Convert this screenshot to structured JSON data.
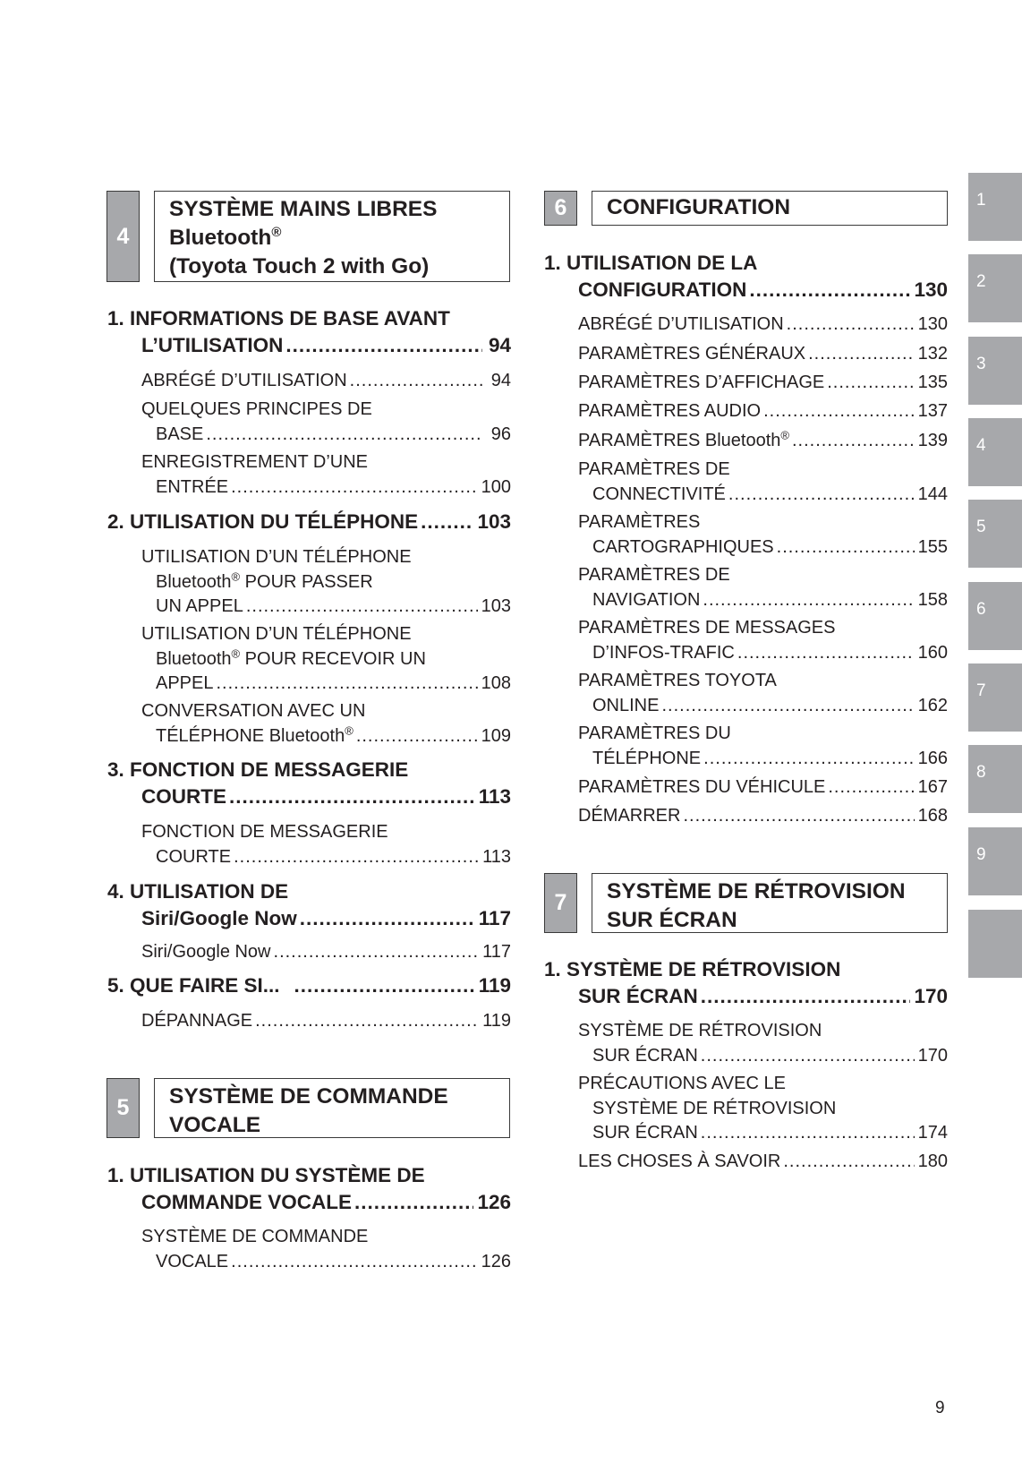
{
  "side_tabs": [
    "1",
    "2",
    "3",
    "4",
    "5",
    "6",
    "7",
    "8",
    "9",
    ""
  ],
  "page_number": "9",
  "chapter4": {
    "number": "4",
    "title_line1": "SYSTÈME MAINS LIBRES",
    "title_line2": "Bluetooth",
    "title_line2_sup": "®",
    "title_line3": "(Toyota Touch 2 with Go)",
    "sections": [
      {
        "label_l1": "1. INFORMATIONS DE BASE AVANT",
        "label_l2": "L’UTILISATION",
        "page": "94",
        "items": [
          {
            "label": "ABRÉGÉ D’UTILISATION",
            "page": "94"
          },
          {
            "label_l1": "QUELQUES PRINCIPES DE",
            "label_l2": "BASE",
            "page": "96"
          },
          {
            "label_l1": "ENREGISTREMENT D’UNE",
            "label_l2": "ENTRÉE",
            "page": "100"
          }
        ]
      },
      {
        "label": "2. UTILISATION DU TÉLÉPHONE",
        "page": "103",
        "items": [
          {
            "label_l1": "UTILISATION D’UN TÉLÉPHONE",
            "label_l2a": "Bluetooth",
            "label_l2sup": "®",
            "label_l2b": " POUR PASSER",
            "label_l3": "UN APPEL",
            "page": "103"
          },
          {
            "label_l1": "UTILISATION D’UN TÉLÉPHONE",
            "label_l2a": "Bluetooth",
            "label_l2sup": "®",
            "label_l2b": " POUR RECEVOIR UN",
            "label_l3": "APPEL",
            "page": "108"
          },
          {
            "label_l1": "CONVERSATION AVEC UN",
            "label_l2a": "TÉLÉPHONE Bluetooth",
            "label_l2sup": "®",
            "page": "109"
          }
        ]
      },
      {
        "label_l1": "3. FONCTION DE MESSAGERIE",
        "label_l2": "COURTE",
        "page": "113",
        "items": [
          {
            "label_l1": "FONCTION DE MESSAGERIE",
            "label_l2": "COURTE",
            "page": "113"
          }
        ]
      },
      {
        "label_l1": "4. UTILISATION DE",
        "label_l2": "Siri/Google Now",
        "page": "117",
        "items": [
          {
            "label": "Siri/Google Now",
            "page": "117"
          }
        ]
      },
      {
        "label": "5. QUE FAIRE SI...",
        "page": "119",
        "items": [
          {
            "label": "DÉPANNAGE",
            "page": "119"
          }
        ]
      }
    ]
  },
  "chapter5": {
    "number": "5",
    "title_line1": "SYSTÈME DE COMMANDE",
    "title_line2": "VOCALE",
    "sections": [
      {
        "label_l1": "1. UTILISATION DU SYSTÈME DE",
        "label_l2": "COMMANDE VOCALE",
        "page": "126",
        "items": [
          {
            "label_l1": "SYSTÈME DE COMMANDE",
            "label_l2": "VOCALE",
            "page": "126"
          }
        ]
      }
    ]
  },
  "chapter6": {
    "number": "6",
    "title_line1": "CONFIGURATION",
    "sections": [
      {
        "label_l1": "1. UTILISATION DE LA",
        "label_l2": "CONFIGURATION",
        "page": "130",
        "items": [
          {
            "label": "ABRÉGÉ D’UTILISATION",
            "page": "130"
          },
          {
            "label": "PARAMÈTRES GÉNÉRAUX",
            "page": "132"
          },
          {
            "label": "PARAMÈTRES D’AFFICHAGE",
            "page": "135"
          },
          {
            "label": "PARAMÈTRES AUDIO",
            "page": "137"
          },
          {
            "label": "PARAMÈTRES Bluetooth",
            "label_sup": "®",
            "page": "139"
          },
          {
            "label_l1": "PARAMÈTRES DE",
            "label_l2": "CONNECTIVITÉ",
            "page": "144"
          },
          {
            "label_l1": "PARAMÈTRES",
            "label_l2": "CARTOGRAPHIQUES",
            "page": "155"
          },
          {
            "label_l1": "PARAMÈTRES DE",
            "label_l2": "NAVIGATION",
            "page": "158"
          },
          {
            "label_l1": "PARAMÈTRES DE MESSAGES",
            "label_l2": "D’INFOS-TRAFIC",
            "page": "160"
          },
          {
            "label_l1": "PARAMÈTRES TOYOTA",
            "label_l2": "ONLINE",
            "page": "162"
          },
          {
            "label_l1": "PARAMÈTRES DU",
            "label_l2": "TÉLÉPHONE",
            "page": "166"
          },
          {
            "label": "PARAMÈTRES DU VÉHICULE",
            "page": "167"
          },
          {
            "label": "DÉMARRER",
            "page": "168"
          }
        ]
      }
    ]
  },
  "chapter7": {
    "number": "7",
    "title_line1": "SYSTÈME DE RÉTROVISION",
    "title_line2": "SUR ÉCRAN",
    "sections": [
      {
        "label_l1": "1. SYSTÈME DE RÉTROVISION",
        "label_l2": "SUR ÉCRAN",
        "page": "170",
        "items": [
          {
            "label_l1": "SYSTÈME DE RÉTROVISION",
            "label_l2": "SUR ÉCRAN",
            "page": "170"
          },
          {
            "label_l1": "PRÉCAUTIONS AVEC LE",
            "label_l2": "SYSTÈME DE RÉTROVISION",
            "label_l3": "SUR ÉCRAN",
            "page": "174"
          },
          {
            "label": "LES CHOSES À SAVOIR",
            "page": "180"
          }
        ]
      }
    ]
  }
}
